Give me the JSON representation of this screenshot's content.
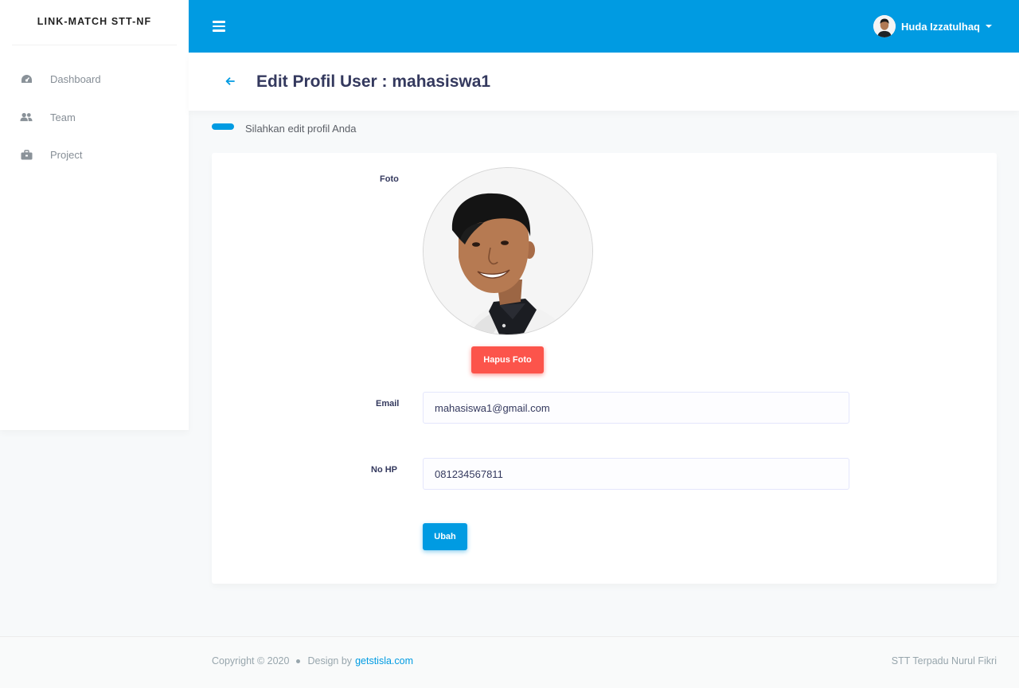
{
  "sidebar": {
    "brand": "LINK-MATCH STT-NF",
    "items": [
      {
        "label": "Dashboard",
        "icon": "dashboard-icon"
      },
      {
        "label": "Team",
        "icon": "users-icon"
      },
      {
        "label": "Project",
        "icon": "briefcase-icon"
      }
    ]
  },
  "navbar": {
    "user_name": "Huda Izzatulhaq",
    "avatar": "user-avatar"
  },
  "header": {
    "title": "Edit Profil User : mahasiswa1"
  },
  "lead": {
    "text": "Silahkan edit profil Anda"
  },
  "form": {
    "photo_label": "Foto",
    "delete_photo_label": "Hapus Foto",
    "email_label": "Email",
    "email_value": "mahasiswa1@gmail.com",
    "phone_label": "No HP",
    "phone_value": "081234567811",
    "submit_label": "Ubah"
  },
  "footer": {
    "copyright": "Copyright © 2020",
    "design_by": "Design by",
    "design_link": "getstisla.com",
    "right_text": "STT Terpadu Nurul Fikri"
  },
  "colors": {
    "primary": "#009be2",
    "danger": "#fc544b",
    "text": "#34395e",
    "muted": "#868e96"
  }
}
